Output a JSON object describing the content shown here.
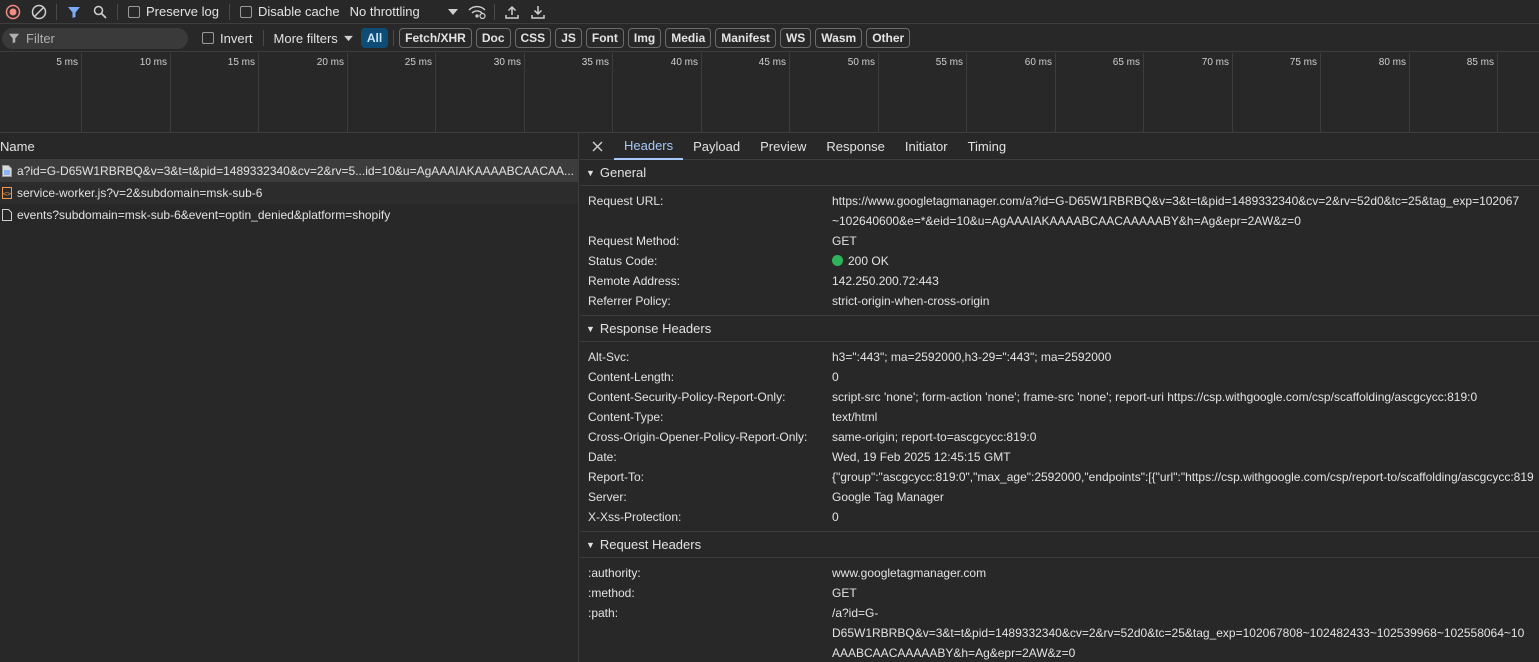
{
  "toolbar": {
    "preserve_log": "Preserve log",
    "disable_cache": "Disable cache",
    "throttling": "No throttling"
  },
  "filterbar": {
    "filter_placeholder": "Filter",
    "invert": "Invert",
    "more_filters": "More filters",
    "chips": [
      "All",
      "Fetch/XHR",
      "Doc",
      "CSS",
      "JS",
      "Font",
      "Img",
      "Media",
      "Manifest",
      "WS",
      "Wasm",
      "Other"
    ]
  },
  "timeline": {
    "ticks": [
      "5 ms",
      "10 ms",
      "15 ms",
      "20 ms",
      "25 ms",
      "30 ms",
      "35 ms",
      "40 ms",
      "45 ms",
      "50 ms",
      "55 ms",
      "60 ms",
      "65 ms",
      "70 ms",
      "75 ms",
      "80 ms",
      "85 ms"
    ]
  },
  "requests": {
    "header": "Name",
    "items": [
      "a?id=G-D65W1RBRBQ&v=3&t=t&pid=1489332340&cv=2&rv=5...id=10&u=AgAAAIAKAAAABCAACAA...",
      "service-worker.js?v=2&subdomain=msk-sub-6",
      "events?subdomain=msk-sub-6&event=optin_denied&platform=shopify"
    ]
  },
  "details": {
    "tabs": [
      "Headers",
      "Payload",
      "Preview",
      "Response",
      "Initiator",
      "Timing"
    ],
    "general": {
      "title": "General",
      "request_url_label": "Request URL:",
      "request_url_line1": "https://www.googletagmanager.com/a?id=G-D65W1RBRBQ&v=3&t=t&pid=1489332340&cv=2&rv=52d0&tc=25&tag_exp=102067",
      "request_url_line2": "~102640600&e=*&eid=10&u=AgAAAIAKAAAABCAACAAAAABY&h=Ag&epr=2AW&z=0",
      "request_method_label": "Request Method:",
      "request_method": "GET",
      "status_code_label": "Status Code:",
      "status_code": "200 OK",
      "remote_address_label": "Remote Address:",
      "remote_address": "142.250.200.72:443",
      "referrer_policy_label": "Referrer Policy:",
      "referrer_policy": "strict-origin-when-cross-origin"
    },
    "response_headers": {
      "title": "Response Headers",
      "rows": [
        {
          "k": "Alt-Svc:",
          "v": "h3=\":443\"; ma=2592000,h3-29=\":443\"; ma=2592000"
        },
        {
          "k": "Content-Length:",
          "v": "0"
        },
        {
          "k": "Content-Security-Policy-Report-Only:",
          "v": "script-src 'none'; form-action 'none'; frame-src 'none'; report-uri https://csp.withgoogle.com/csp/scaffolding/ascgcycc:819:0"
        },
        {
          "k": "Content-Type:",
          "v": "text/html"
        },
        {
          "k": "Cross-Origin-Opener-Policy-Report-Only:",
          "v": "same-origin; report-to=ascgcycc:819:0"
        },
        {
          "k": "Date:",
          "v": "Wed, 19 Feb 2025 12:45:15 GMT"
        },
        {
          "k": "Report-To:",
          "v": "{\"group\":\"ascgcycc:819:0\",\"max_age\":2592000,\"endpoints\":[{\"url\":\"https://csp.withgoogle.com/csp/report-to/scaffolding/ascgcycc:819"
        },
        {
          "k": "Server:",
          "v": "Google Tag Manager"
        },
        {
          "k": "X-Xss-Protection:",
          "v": "0"
        }
      ]
    },
    "request_headers": {
      "title": "Request Headers",
      "authority_label": ":authority:",
      "authority": "www.googletagmanager.com",
      "method_label": ":method:",
      "method": "GET",
      "path_label": ":path:",
      "path_line1": "/a?id=G-",
      "path_line2": "D65W1RBRBQ&v=3&t=t&pid=1489332340&cv=2&rv=52d0&tc=25&tag_exp=102067808~102482433~102539968~102558064~10",
      "path_line3": "AAABCAACAAAAABY&h=Ag&epr=2AW&z=0"
    }
  },
  "colors": {
    "accent": "#a8c7fa",
    "record_red": "#f28b82",
    "filter_blue": "#7cacf8",
    "status_green": "#2fb35a",
    "chip_active_bg": "#0f4c75"
  }
}
